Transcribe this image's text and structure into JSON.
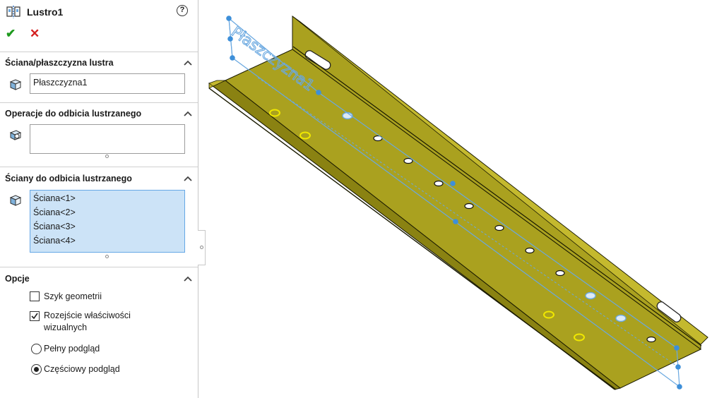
{
  "feature": {
    "title": "Lustro1",
    "help": "?"
  },
  "actions": {
    "ok": "✔",
    "cancel": "✕"
  },
  "sections": {
    "plane": {
      "title": "Ściana/płaszczyzna lustra",
      "value": "Płaszczyzna1"
    },
    "features": {
      "title": "Operacje do odbicia lustrzanego",
      "items": []
    },
    "faces": {
      "title": "Ściany do odbicia lustrzanego",
      "items": [
        "Ściana<1>",
        "Ściana<2>",
        "Ściana<3>",
        "Ściana<4>"
      ]
    },
    "options": {
      "title": "Opcje",
      "geometry_pattern": {
        "label": "Szyk geometrii",
        "checked": false
      },
      "propagate_visual": {
        "label_line1": "Rozejście właściwości",
        "label_line2": "wizualnych",
        "checked": true
      },
      "full_preview": {
        "label": "Pełny podgląd",
        "selected": false
      },
      "partial_preview": {
        "label": "Częściowy podgląd",
        "selected": true
      }
    }
  },
  "viewport": {
    "plane_label": "Płaszczyzna1",
    "colors": {
      "part": "#aaa11f",
      "part_light": "#c4b92e",
      "part_dark": "#7f7810",
      "plane": "#6aa8e0",
      "highlight": "#f0e800"
    }
  }
}
